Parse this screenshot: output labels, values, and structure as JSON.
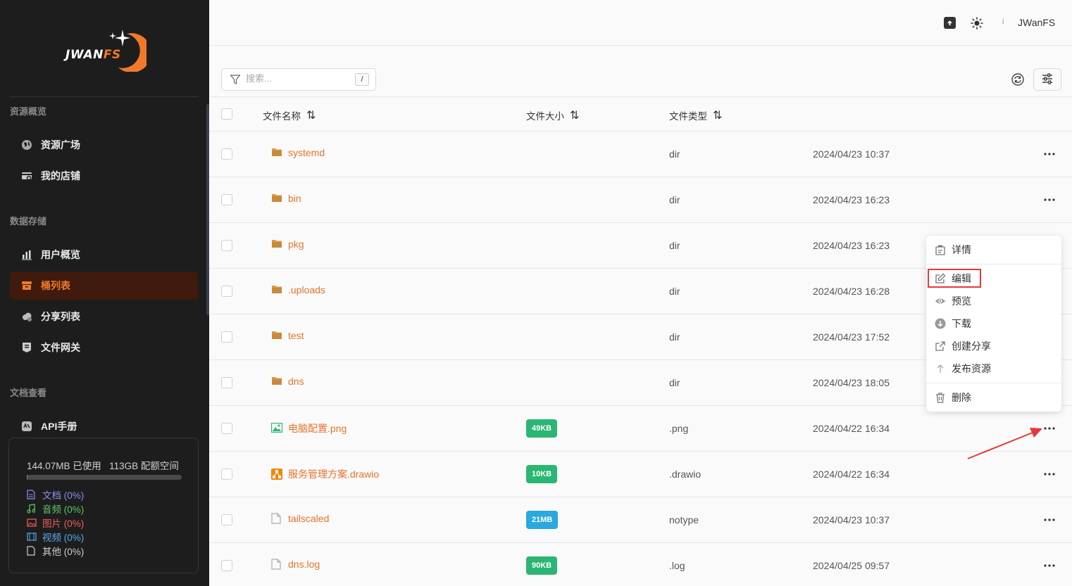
{
  "app": {
    "logo_main": "JWAN",
    "logo_accent": "FS"
  },
  "sidebar": {
    "sections": [
      {
        "title": "资源概览"
      },
      {
        "title": "数据存储"
      },
      {
        "title": "文档查看"
      }
    ],
    "items": [
      {
        "label": "资源广场",
        "icon": "globe-icon"
      },
      {
        "label": "我的店铺",
        "icon": "store-icon"
      },
      {
        "label": "用户概览",
        "icon": "bar-chart-icon"
      },
      {
        "label": "桶列表",
        "icon": "bucket-icon",
        "active": true
      },
      {
        "label": "分享列表",
        "icon": "cloud-share-icon"
      },
      {
        "label": "文件网关",
        "icon": "gateway-icon"
      },
      {
        "label": "API手册",
        "icon": "api-icon"
      }
    ],
    "storage": {
      "used": "144.07MB 已使用",
      "quota": "113GB 配额空间",
      "used_fraction": 0.001,
      "legend": [
        {
          "label": "文档 (0%)",
          "color": "#8b8ff0",
          "icon": "document-icon"
        },
        {
          "label": "音频 (0%)",
          "color": "#5cc76a",
          "icon": "music-icon"
        },
        {
          "label": "图片 (0%)",
          "color": "#f0605a",
          "icon": "image-icon"
        },
        {
          "label": "视频 (0%)",
          "color": "#5aa8f0",
          "icon": "film-icon"
        },
        {
          "label": "其他 (0%)",
          "color": "#cfcfcf",
          "icon": "file-icon"
        }
      ]
    }
  },
  "header": {
    "info": "i",
    "user": "JWanFS"
  },
  "toolbar": {
    "search_placeholder": "搜索...",
    "shortcut": "/"
  },
  "table": {
    "columns": {
      "name": "文件名称",
      "size": "文件大小",
      "type": "文件类型",
      "sort_icon": "⇅"
    },
    "rows": [
      {
        "name": "systemd",
        "icon": "folder-icon",
        "size": "",
        "type": "dir",
        "date": "2024/04/23 10:37"
      },
      {
        "name": "bin",
        "icon": "folder-icon",
        "size": "",
        "type": "dir",
        "date": "2024/04/23 16:23"
      },
      {
        "name": "pkg",
        "icon": "folder-icon",
        "size": "",
        "type": "dir",
        "date": "2024/04/23 16:23"
      },
      {
        "name": ".uploads",
        "icon": "folder-icon",
        "size": "",
        "type": "dir",
        "date": "2024/04/23 16:28"
      },
      {
        "name": "test",
        "icon": "folder-icon",
        "size": "",
        "type": "dir",
        "date": "2024/04/23 17:52"
      },
      {
        "name": "dns",
        "icon": "folder-icon",
        "size": "",
        "type": "dir",
        "date": "2024/04/23 18:05"
      },
      {
        "name": "电脑配置.png",
        "icon": "image-file-icon",
        "size": "49KB",
        "size_color": "#2bb673",
        "type": ".png",
        "date": "2024/04/22 16:34"
      },
      {
        "name": "服务管理方案.drawio",
        "icon": "drawio-icon",
        "size": "10KB",
        "size_color": "#2bb673",
        "type": ".drawio",
        "date": "2024/04/22 16:34"
      },
      {
        "name": "tailscaled",
        "icon": "file-icon",
        "size": "21MB",
        "size_color": "#2aa8e0",
        "type": "notype",
        "date": "2024/04/23 10:37"
      },
      {
        "name": "dns.log",
        "icon": "file-icon",
        "size": "90KB",
        "size_color": "#2bb673",
        "type": ".log",
        "date": "2024/04/25 09:57"
      }
    ]
  },
  "context_menu": {
    "items": [
      {
        "label": "详情",
        "icon": "details-icon"
      },
      {
        "label": "编辑",
        "icon": "edit-icon"
      },
      {
        "label": "预览",
        "icon": "eye-icon"
      },
      {
        "label": "下载",
        "icon": "download-icon"
      },
      {
        "label": "创建分享",
        "icon": "external-link-icon"
      },
      {
        "label": "发布资源",
        "icon": "publish-icon"
      },
      {
        "label": "删除",
        "icon": "trash-icon"
      }
    ]
  },
  "colors": {
    "accent": "#e8732a",
    "sidebar_bg": "#1d1d1d",
    "active_bg": "#3f1a0d",
    "highlight": "#e53935"
  }
}
